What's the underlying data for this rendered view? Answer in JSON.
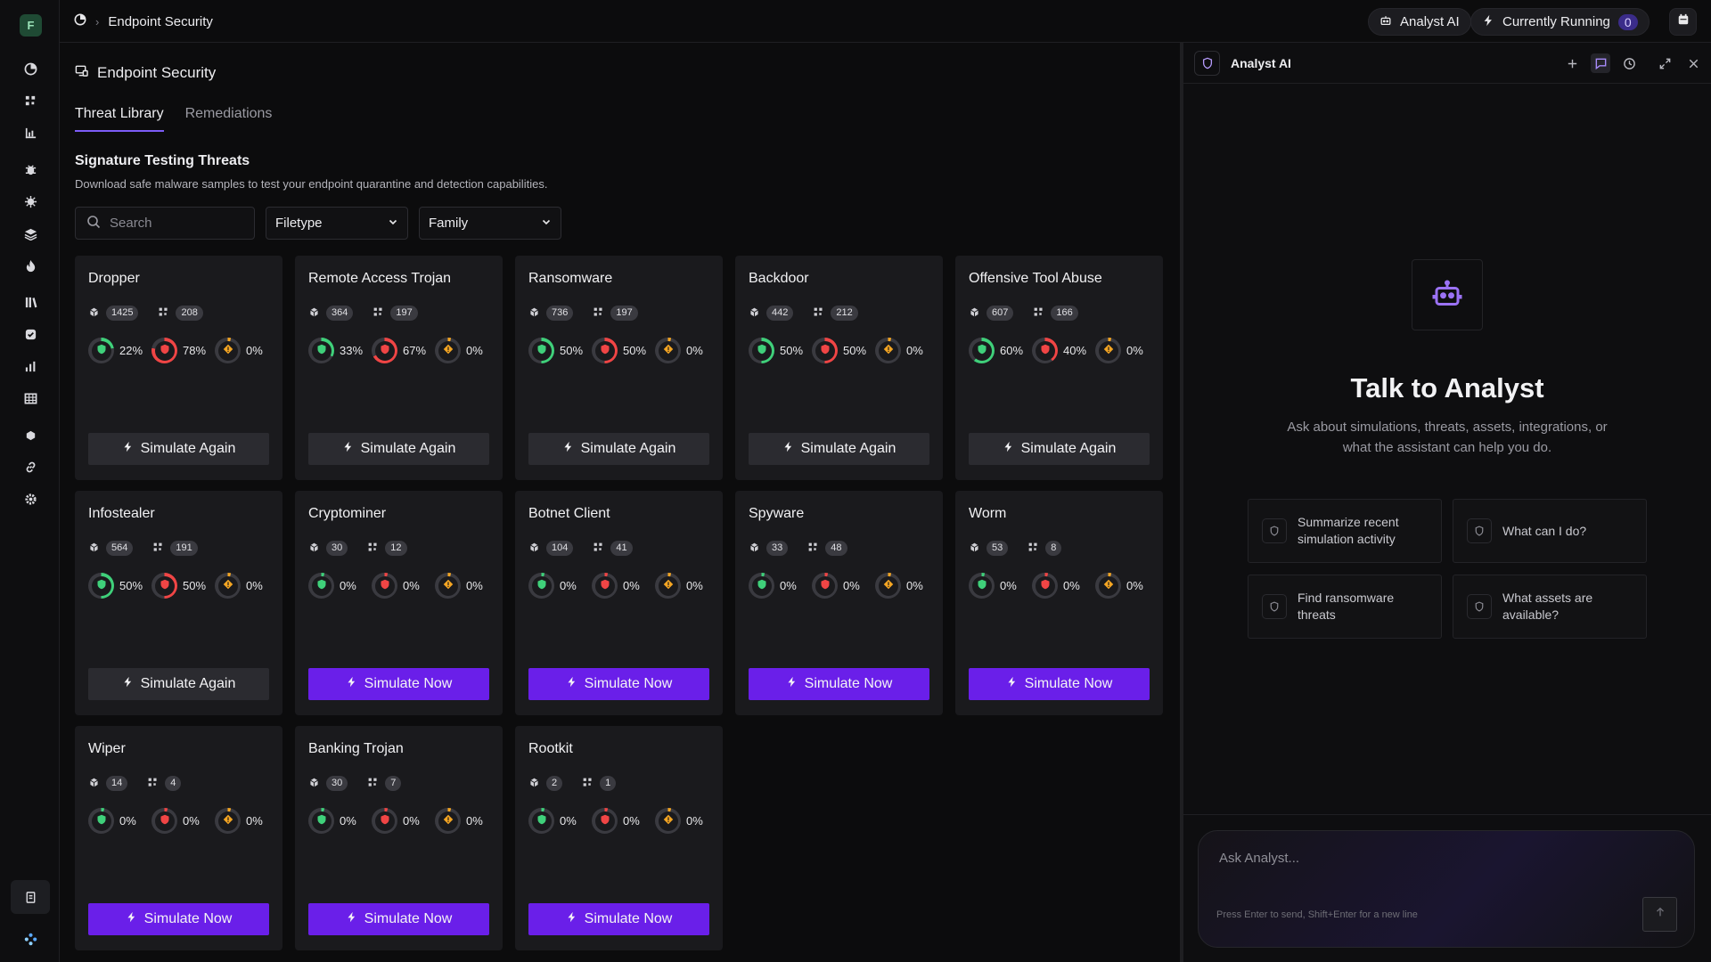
{
  "org": {
    "initial": "F"
  },
  "breadcrumb": {
    "current": "Endpoint Security"
  },
  "topbar": {
    "analyst_label": "Analyst AI",
    "running_label": "Currently Running",
    "running_count": "0"
  },
  "page": {
    "title": "Endpoint Security"
  },
  "tabs": [
    {
      "label": "Threat Library",
      "active": true
    },
    {
      "label": "Remediations",
      "active": false
    }
  ],
  "section": {
    "title": "Signature Testing Threats",
    "subtitle": "Download safe malware samples to test your endpoint quarantine and detection capabilities."
  },
  "filters": {
    "search_placeholder": "Search",
    "filetype_label": "Filetype",
    "family_label": "Family"
  },
  "colors": {
    "accent": "#6a1fe9",
    "success": "#3fd07a",
    "danger": "#f04545",
    "warning": "#f5a623"
  },
  "threats": [
    {
      "name": "Dropper",
      "samples": "1425",
      "variants": "208",
      "detected": "22%",
      "failed": "78%",
      "other": "0%",
      "detected_val": 22,
      "failed_val": 78,
      "other_val": 0,
      "button": "Simulate Again",
      "button_type": "again"
    },
    {
      "name": "Remote Access Trojan",
      "samples": "364",
      "variants": "197",
      "detected": "33%",
      "failed": "67%",
      "other": "0%",
      "detected_val": 33,
      "failed_val": 67,
      "other_val": 0,
      "button": "Simulate Again",
      "button_type": "again"
    },
    {
      "name": "Ransomware",
      "samples": "736",
      "variants": "197",
      "detected": "50%",
      "failed": "50%",
      "other": "0%",
      "detected_val": 50,
      "failed_val": 50,
      "other_val": 0,
      "button": "Simulate Again",
      "button_type": "again"
    },
    {
      "name": "Backdoor",
      "samples": "442",
      "variants": "212",
      "detected": "50%",
      "failed": "50%",
      "other": "0%",
      "detected_val": 50,
      "failed_val": 50,
      "other_val": 0,
      "button": "Simulate Again",
      "button_type": "again"
    },
    {
      "name": "Offensive Tool Abuse",
      "samples": "607",
      "variants": "166",
      "detected": "60%",
      "failed": "40%",
      "other": "0%",
      "detected_val": 60,
      "failed_val": 40,
      "other_val": 0,
      "button": "Simulate Again",
      "button_type": "again"
    },
    {
      "name": "Infostealer",
      "samples": "564",
      "variants": "191",
      "detected": "50%",
      "failed": "50%",
      "other": "0%",
      "detected_val": 50,
      "failed_val": 50,
      "other_val": 0,
      "button": "Simulate Again",
      "button_type": "again"
    },
    {
      "name": "Cryptominer",
      "samples": "30",
      "variants": "12",
      "detected": "0%",
      "failed": "0%",
      "other": "0%",
      "detected_val": 0,
      "failed_val": 0,
      "other_val": 0,
      "button": "Simulate Now",
      "button_type": "now"
    },
    {
      "name": "Botnet Client",
      "samples": "104",
      "variants": "41",
      "detected": "0%",
      "failed": "0%",
      "other": "0%",
      "detected_val": 0,
      "failed_val": 0,
      "other_val": 0,
      "button": "Simulate Now",
      "button_type": "now"
    },
    {
      "name": "Spyware",
      "samples": "33",
      "variants": "48",
      "detected": "0%",
      "failed": "0%",
      "other": "0%",
      "detected_val": 0,
      "failed_val": 0,
      "other_val": 0,
      "button": "Simulate Now",
      "button_type": "now"
    },
    {
      "name": "Worm",
      "samples": "53",
      "variants": "8",
      "detected": "0%",
      "failed": "0%",
      "other": "0%",
      "detected_val": 0,
      "failed_val": 0,
      "other_val": 0,
      "button": "Simulate Now",
      "button_type": "now"
    },
    {
      "name": "Wiper",
      "samples": "14",
      "variants": "4",
      "detected": "0%",
      "failed": "0%",
      "other": "0%",
      "detected_val": 0,
      "failed_val": 0,
      "other_val": 0,
      "button": "Simulate Now",
      "button_type": "now"
    },
    {
      "name": "Banking Trojan",
      "samples": "30",
      "variants": "7",
      "detected": "0%",
      "failed": "0%",
      "other": "0%",
      "detected_val": 0,
      "failed_val": 0,
      "other_val": 0,
      "button": "Simulate Now",
      "button_type": "now"
    },
    {
      "name": "Rootkit",
      "samples": "2",
      "variants": "1",
      "detected": "0%",
      "failed": "0%",
      "other": "0%",
      "detected_val": 0,
      "failed_val": 0,
      "other_val": 0,
      "button": "Simulate Now",
      "button_type": "now"
    }
  ],
  "analyst": {
    "title": "Analyst AI",
    "heading": "Talk to Analyst",
    "subheading": "Ask about simulations, threats, assets, integrations, or what the assistant can help you do.",
    "suggestions": [
      {
        "label": "Summarize recent simulation activity"
      },
      {
        "label": "What can I do?"
      },
      {
        "label": "Find ransomware threats"
      },
      {
        "label": "What assets are available?"
      }
    ],
    "input_placeholder": "Ask Analyst...",
    "input_hint": "Press Enter to send, Shift+Enter for a new line"
  },
  "sidebar_icons": [
    "dashboard-icon",
    "grid-dots-icon",
    "bar-chart-icon",
    "bug-icon",
    "virus-icon",
    "layers-icon",
    "flame-icon",
    "library-icon",
    "shield-check-icon",
    "analytics-icon",
    "table-icon",
    "cloud-icon",
    "link-icon",
    "settings-icon",
    "document-icon",
    "network-icon"
  ]
}
